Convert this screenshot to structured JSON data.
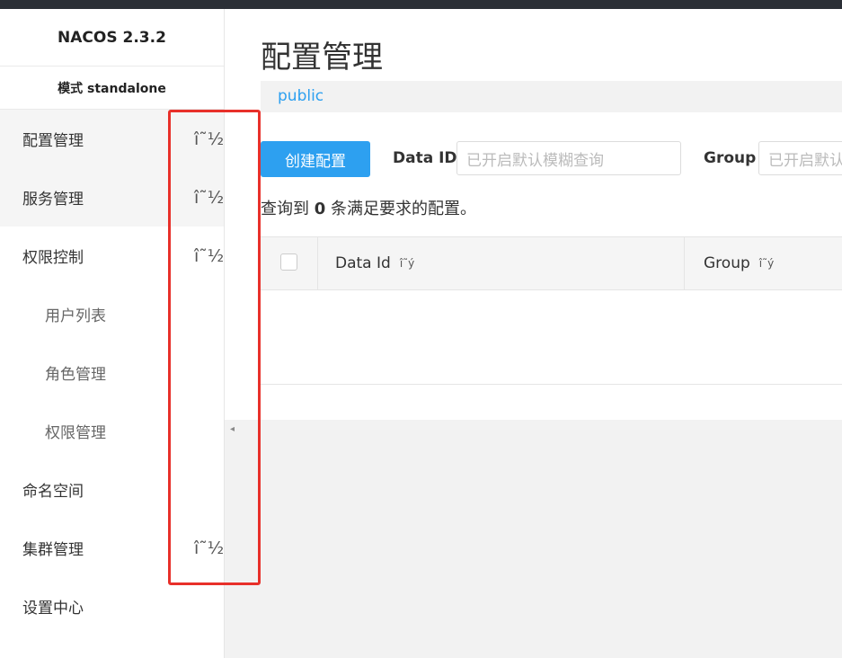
{
  "app": {
    "brand": "NACOS 2.3.2",
    "mode": "模式 standalone"
  },
  "sidebar": {
    "items": [
      {
        "label": "配置管理",
        "arrow": "î˜½"
      },
      {
        "label": "服务管理",
        "arrow": "î˜½"
      },
      {
        "label": "权限控制",
        "arrow": "î˜½"
      },
      {
        "label": "用户列表"
      },
      {
        "label": "角色管理"
      },
      {
        "label": "权限管理"
      },
      {
        "label": "命名空间"
      },
      {
        "label": "集群管理",
        "arrow": "î˜½"
      },
      {
        "label": "设置中心"
      }
    ]
  },
  "main": {
    "title": "配置管理",
    "namespace": "public",
    "create_button": "创建配置",
    "filters": {
      "data_id_label": "Data ID",
      "data_id_placeholder": "已开启默认模糊查询",
      "group_label": "Group",
      "group_placeholder": "已开启默认模糊查询"
    },
    "result": {
      "prefix": "查询到",
      "count": "0",
      "suffix": "条满足要求的配置。"
    },
    "table": {
      "columns": [
        {
          "label": "Data Id",
          "sort": "î˜ý"
        },
        {
          "label": "Group",
          "sort": "î˜ý"
        }
      ]
    }
  },
  "colors": {
    "accent": "#2da0f0",
    "highlight": "#e8302a",
    "topbar": "#2b2f36"
  },
  "icons": {
    "scroll_left": "◂"
  }
}
